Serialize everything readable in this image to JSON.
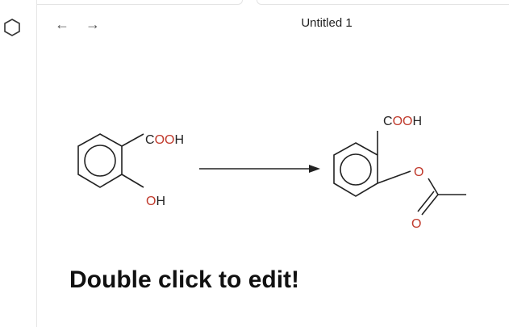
{
  "window": {
    "title": "Untitled 1"
  },
  "icons": {
    "app_logo": "hexagon-icon",
    "back": "arrow-left-icon",
    "forward": "arrow-right-icon"
  },
  "nav": {
    "back_glyph": "←",
    "forward_glyph": "→"
  },
  "reactant": {
    "group_top": {
      "prefix": "C",
      "red": "OO",
      "suffix": "H"
    },
    "group_bottom": {
      "red": "O",
      "suffix": "H"
    }
  },
  "product": {
    "group_top": {
      "prefix": "C",
      "red": "OO",
      "suffix": "H"
    },
    "ester_oxygen": "O",
    "carbonyl_oxygen": "O"
  },
  "canvas": {
    "hint": "Double click to edit!"
  },
  "colors": {
    "heteroatom": "#c0392b",
    "bond": "#222222"
  }
}
